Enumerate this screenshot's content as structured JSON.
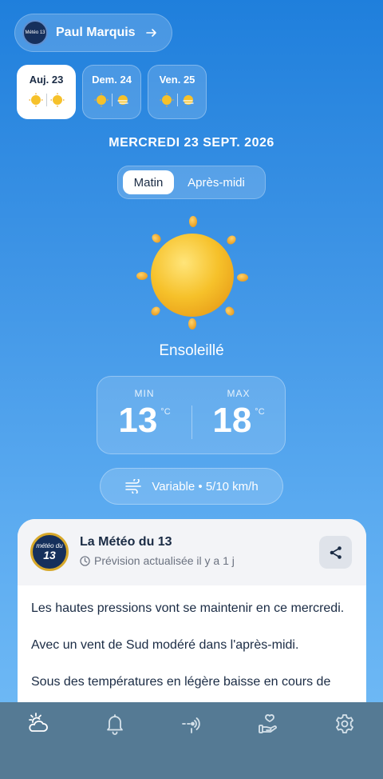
{
  "user": {
    "name": "Paul Marquis",
    "avatar_text": "Météo 13"
  },
  "days": [
    {
      "label": "Auj. 23",
      "active": true
    },
    {
      "label": "Dem. 24",
      "active": false
    },
    {
      "label": "Ven. 25",
      "active": false
    }
  ],
  "date_title": "MERCREDI 23 SEPT. 2026",
  "period_toggle": {
    "morning": "Matin",
    "afternoon": "Après-midi",
    "selected": "Matin"
  },
  "condition": "Ensoleillé",
  "temps": {
    "min_label": "MIN",
    "min_value": "13",
    "max_label": "MAX",
    "max_value": "18",
    "unit": "°C"
  },
  "wind": {
    "text": "Variable • 5/10 km/h"
  },
  "card": {
    "logo_a": "météo du",
    "logo_b": "13",
    "title": "La Météo du 13",
    "subtitle": "Prévision actualisée il y a 1 j",
    "paragraphs": [
      "Les hautes pressions vont se maintenir en ce mercredi.",
      "Avec un vent de Sud modéré dans l'après-midi.",
      "Sous des températures en légère baisse en cours de"
    ]
  },
  "tabbar": {
    "tabs": [
      "weather-icon",
      "bell-icon",
      "radar-icon",
      "hand-heart-icon",
      "gear-icon"
    ],
    "active_color": "#ffffff",
    "color": "#d6e2ea"
  },
  "colors": {
    "sun_core": "#f6c12a",
    "sun_ray": "#f0a92b",
    "navy": "#1a2b44"
  }
}
